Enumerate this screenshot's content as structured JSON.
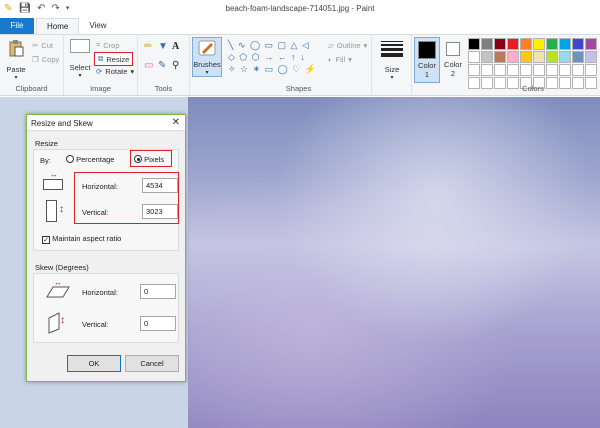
{
  "window": {
    "title": "beach-foam-landscape-714051.jpg - Paint"
  },
  "tabs": [
    {
      "label": "File"
    },
    {
      "label": "Home"
    },
    {
      "label": "View"
    }
  ],
  "ribbon": {
    "clipboard": {
      "group_label": "Clipboard",
      "paste_label": "Paste",
      "cut_label": "Cut",
      "copy_label": "Copy"
    },
    "image": {
      "group_label": "Image",
      "select_label": "Select",
      "crop_label": "Crop",
      "resize_label": "Resize",
      "rotate_label": "Rotate"
    },
    "tools": {
      "group_label": "Tools"
    },
    "brushes": {
      "label": "Brushes"
    },
    "shapes": {
      "group_label": "Shapes",
      "outline_label": "Outline",
      "fill_label": "Fill"
    },
    "size": {
      "label": "Size"
    },
    "color1": {
      "label": "Color 1",
      "value": "#000000"
    },
    "color2": {
      "label": "Color 2",
      "value": "#ffffff"
    },
    "colors": {
      "group_label": "Colors",
      "palette_row1": [
        "#000000",
        "#7f7f7f",
        "#880015",
        "#ed1c24",
        "#ff7f27",
        "#fff200",
        "#22b14c",
        "#00a2e8",
        "#3f48cc",
        "#a349a4"
      ],
      "palette_row2": [
        "#ffffff",
        "#c3c3c3",
        "#b97a57",
        "#ffaec9",
        "#ffc90e",
        "#efe4b0",
        "#b5e61d",
        "#99d9ea",
        "#7092be",
        "#c8bfe7"
      ]
    }
  },
  "dialog": {
    "title": "Resize and Skew",
    "resize_heading": "Resize",
    "by_label": "By:",
    "percentage_label": "Percentage",
    "pixels_label": "Pixels",
    "selected_unit": "Pixels",
    "horizontal_label": "Horizontal:",
    "horizontal_value": "4534",
    "vertical_label": "Vertical:",
    "vertical_value": "3023",
    "aspect_label": "Maintain aspect ratio",
    "aspect_checked": true,
    "skew_heading": "Skew (Degrees)",
    "skew_horizontal_label": "Horizontal:",
    "skew_horizontal_value": "0",
    "skew_vertical_label": "Vertical:",
    "skew_vertical_value": "0",
    "ok_label": "OK",
    "cancel_label": "Cancel"
  }
}
